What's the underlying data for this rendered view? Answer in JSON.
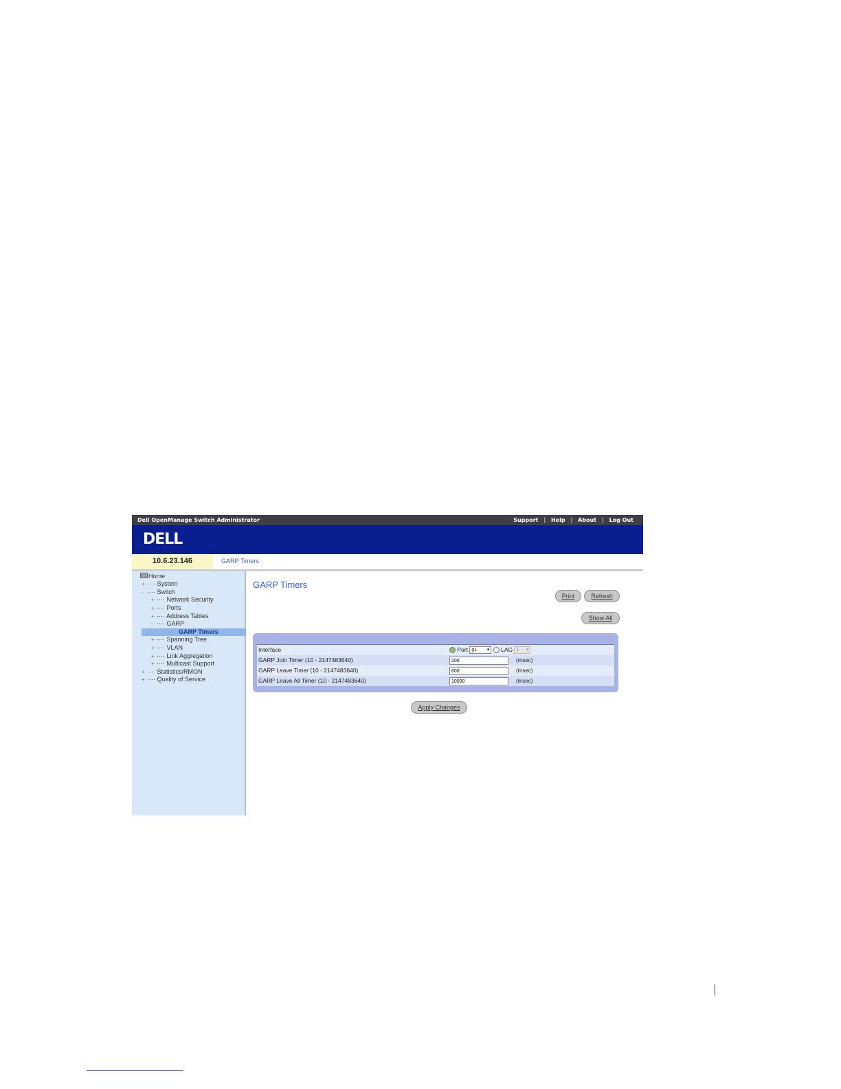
{
  "app": {
    "title": "Dell OpenManage Switch Administrator",
    "logo": "DELL",
    "top_links": [
      "Support",
      "Help",
      "About",
      "Log Out"
    ],
    "ip": "10.6.23.146",
    "breadcrumb": "GARP Timers"
  },
  "sidebar": {
    "items": [
      {
        "label": "Home",
        "exp": ""
      },
      {
        "label": "System",
        "exp": "+"
      },
      {
        "label": "Switch",
        "exp": "-"
      },
      {
        "label": "Network Security",
        "exp": "+"
      },
      {
        "label": "Ports",
        "exp": "+"
      },
      {
        "label": "Address Tables",
        "exp": "+"
      },
      {
        "label": "GARP",
        "exp": "-"
      },
      {
        "label": "GARP Timers",
        "exp": ""
      },
      {
        "label": "Spanning Tree",
        "exp": "+"
      },
      {
        "label": "VLAN",
        "exp": "+"
      },
      {
        "label": "Link Aggregation",
        "exp": "+"
      },
      {
        "label": "Multicast Support",
        "exp": "+"
      },
      {
        "label": "Statistics/RMON",
        "exp": "+"
      },
      {
        "label": "Quality of Service",
        "exp": "+"
      }
    ]
  },
  "main": {
    "title": "GARP Timers",
    "buttons": {
      "print": "Print",
      "refresh": "Refresh",
      "show_all": "Show All",
      "apply": "Apply Changes"
    },
    "interface": {
      "label": "Interface",
      "port_label": "Port",
      "port_value": "g1",
      "lag_label": "LAG",
      "lag_value": "1"
    },
    "fields": [
      {
        "label": "GARP Join Timer (10 - 2147483640)",
        "value": "200",
        "unit": "(msec)"
      },
      {
        "label": "GARP Leave Timer (10 - 2147483640)",
        "value": "600",
        "unit": "(msec)"
      },
      {
        "label": "GARP Leave All Timer (10 - 2147483640)",
        "value": "10000",
        "unit": "(msec)"
      }
    ]
  }
}
